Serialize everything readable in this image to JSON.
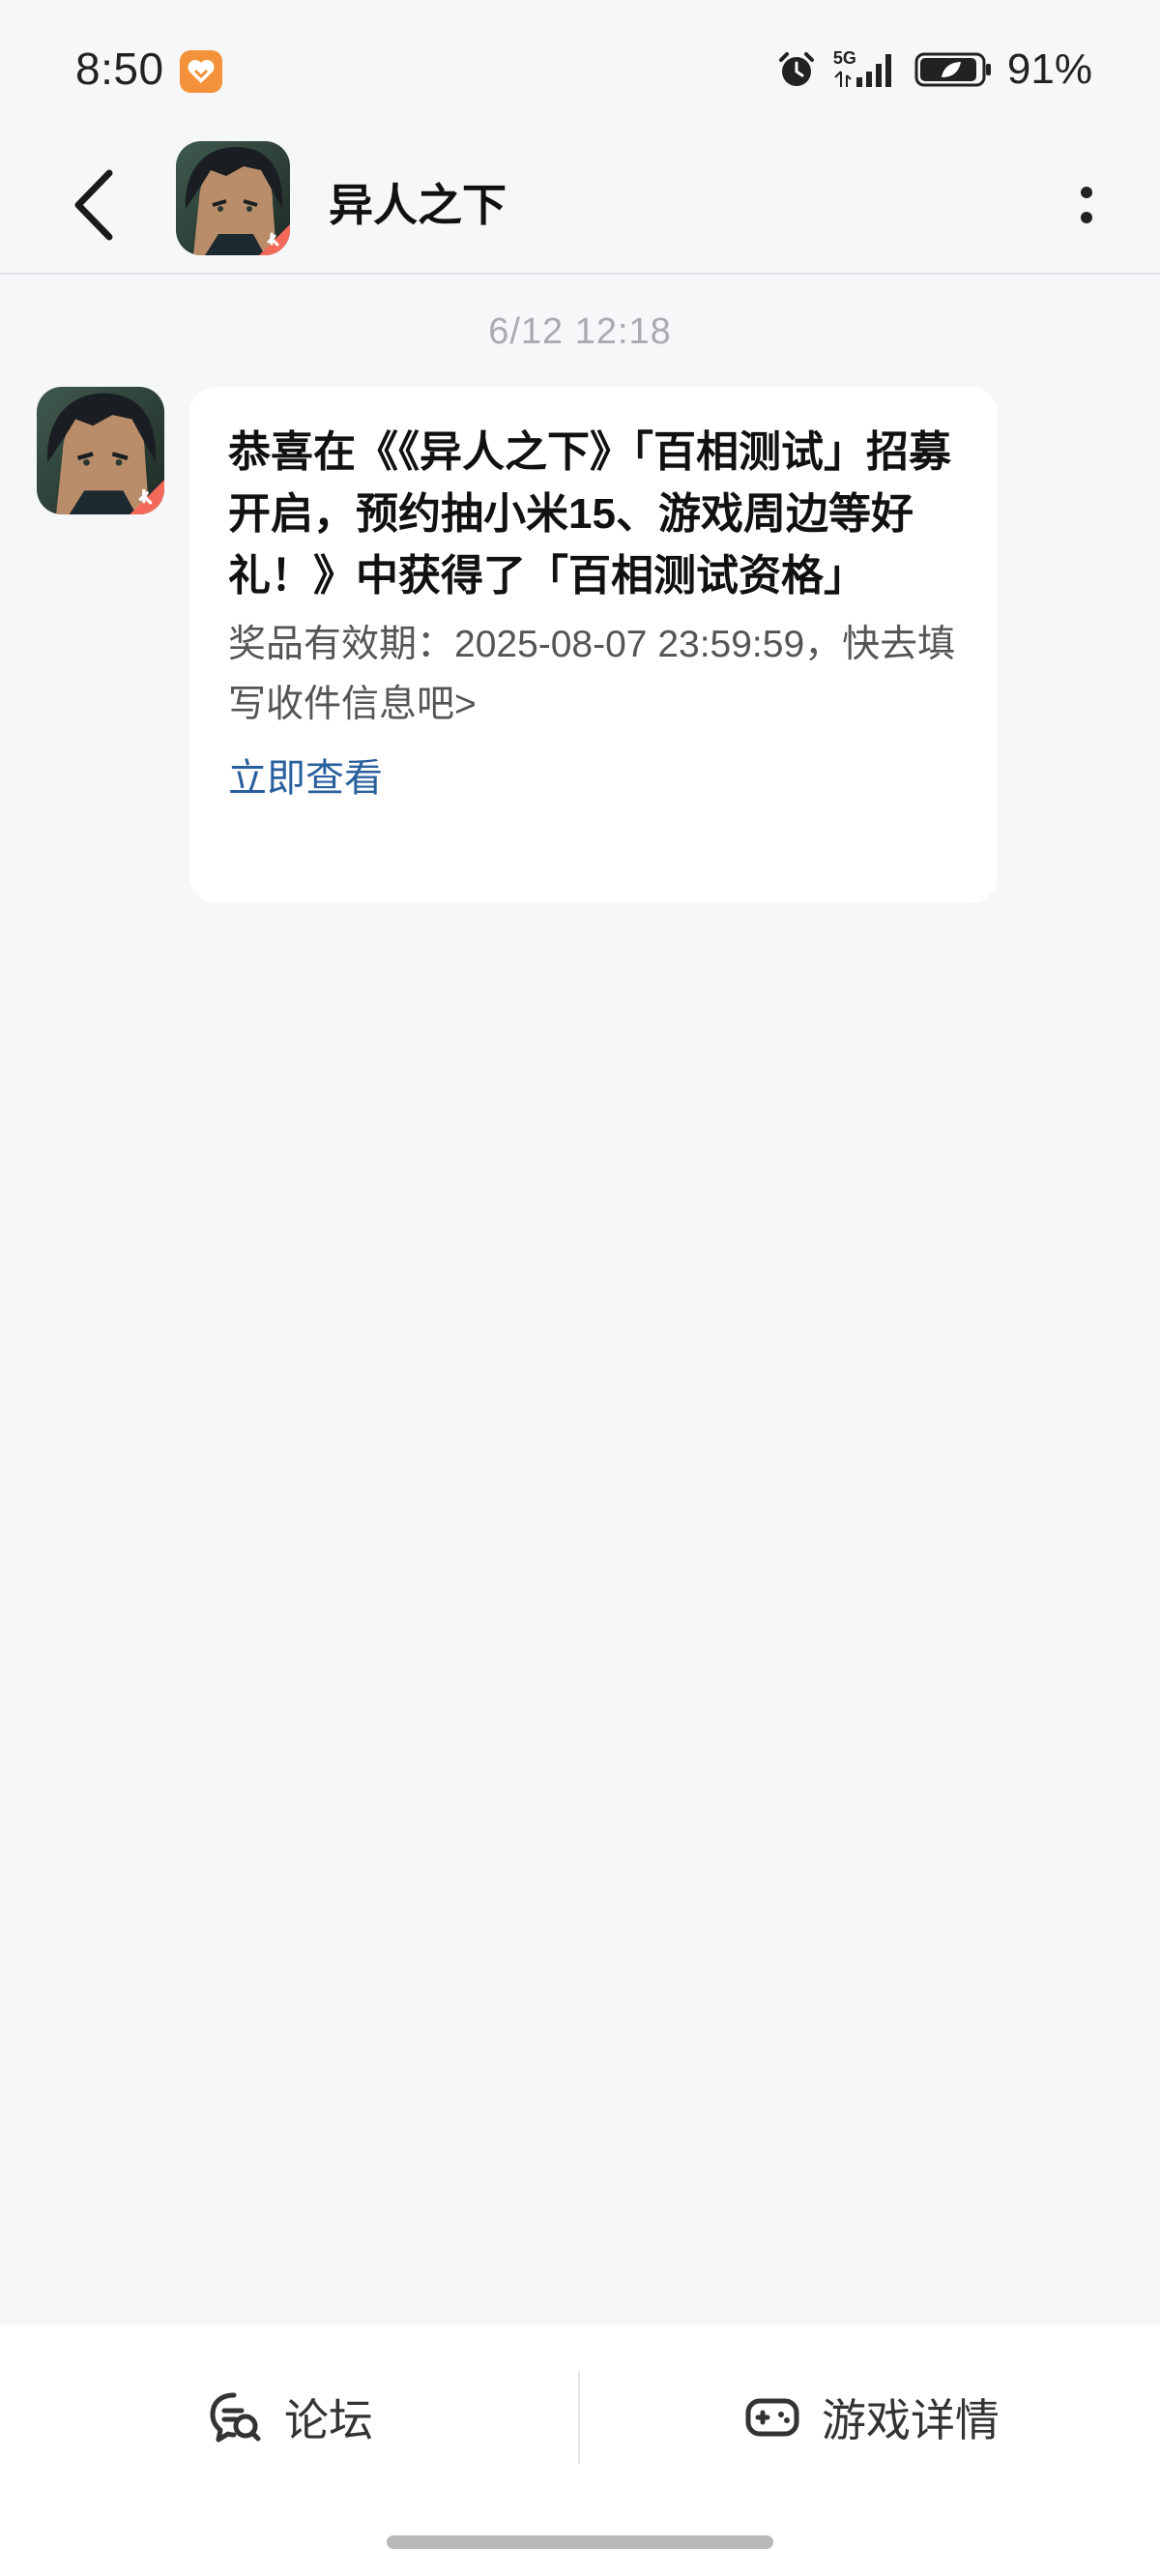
{
  "status_bar": {
    "time": "8:50",
    "network": "5G",
    "battery_text": "91%"
  },
  "header": {
    "title": "异人之下"
  },
  "message": {
    "timestamp": "6/12  12:18",
    "title": "恭喜在《《异人之下》「百相测试」招募开启，预约抽小米15、游戏周边等好礼！》中获得了「百相测试资格」",
    "body": "奖品有效期：2025-08-07 23:59:59，快去填写收件信息吧>",
    "link": "立即查看"
  },
  "bottom_nav": {
    "forum_label": "论坛",
    "game_details_label": "游戏详情"
  },
  "colors": {
    "background": "#f6f7f9",
    "link": "#2a5f9e",
    "badge": "#f4923b"
  }
}
